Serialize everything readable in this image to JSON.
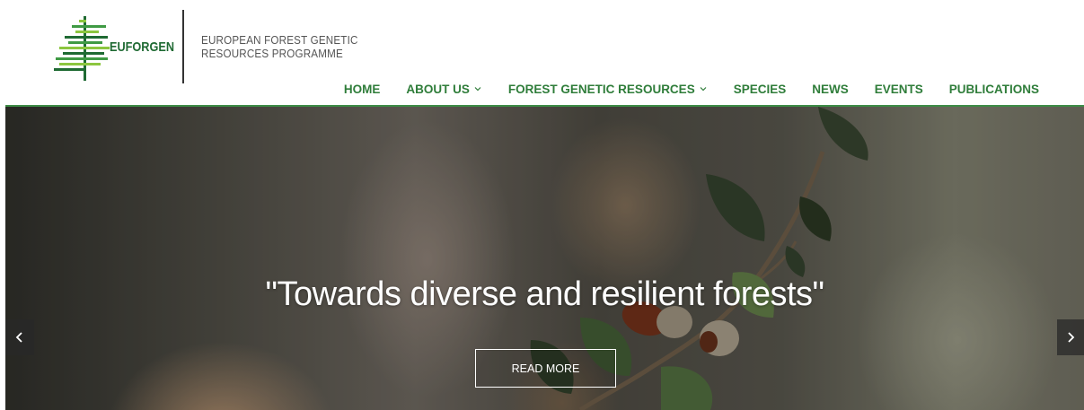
{
  "brand": {
    "logo_text": "EUFORGEN",
    "tagline_line1": "EUROPEAN FOREST GENETIC",
    "tagline_line2": "RESOURCES PROGRAMME",
    "logo_colors": [
      "#1f6a33",
      "#3f9a44",
      "#8cc63f"
    ]
  },
  "nav": {
    "items": [
      {
        "label": "HOME",
        "has_dropdown": false
      },
      {
        "label": "ABOUT US",
        "has_dropdown": true
      },
      {
        "label": "FOREST GENETIC RESOURCES",
        "has_dropdown": true
      },
      {
        "label": "SPECIES",
        "has_dropdown": false
      },
      {
        "label": "NEWS",
        "has_dropdown": false
      },
      {
        "label": "EVENTS",
        "has_dropdown": false
      },
      {
        "label": "PUBLICATIONS",
        "has_dropdown": false
      }
    ],
    "color": "#2f7d3a"
  },
  "hero": {
    "title": "\"Towards diverse and resilient forests\"",
    "cta_label": "READ MORE",
    "prev_icon": "chevron-left-icon",
    "next_icon": "chevron-right-icon"
  }
}
